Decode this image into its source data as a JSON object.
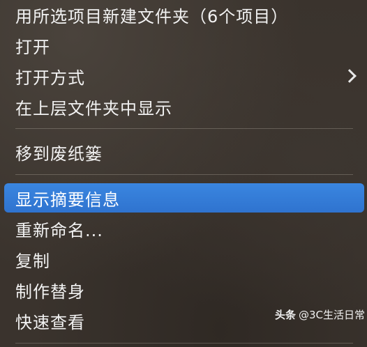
{
  "menu": {
    "items": [
      {
        "label": "用所选项目新建文件夹（6个项目）"
      },
      {
        "label": "打开"
      },
      {
        "label": "打开方式",
        "has_submenu": true
      },
      {
        "label": "在上层文件夹中显示"
      },
      {
        "label": "移到废纸篓"
      },
      {
        "label": "显示摘要信息",
        "selected": true
      },
      {
        "label": "重新命名..."
      },
      {
        "label": "复制"
      },
      {
        "label": "制作替身"
      },
      {
        "label": "快速查看"
      }
    ]
  },
  "watermark": {
    "brand": "头条",
    "handle": "@3C生活日常"
  },
  "colors": {
    "highlight": "#2f73cf",
    "text": "#f2f2f2"
  }
}
